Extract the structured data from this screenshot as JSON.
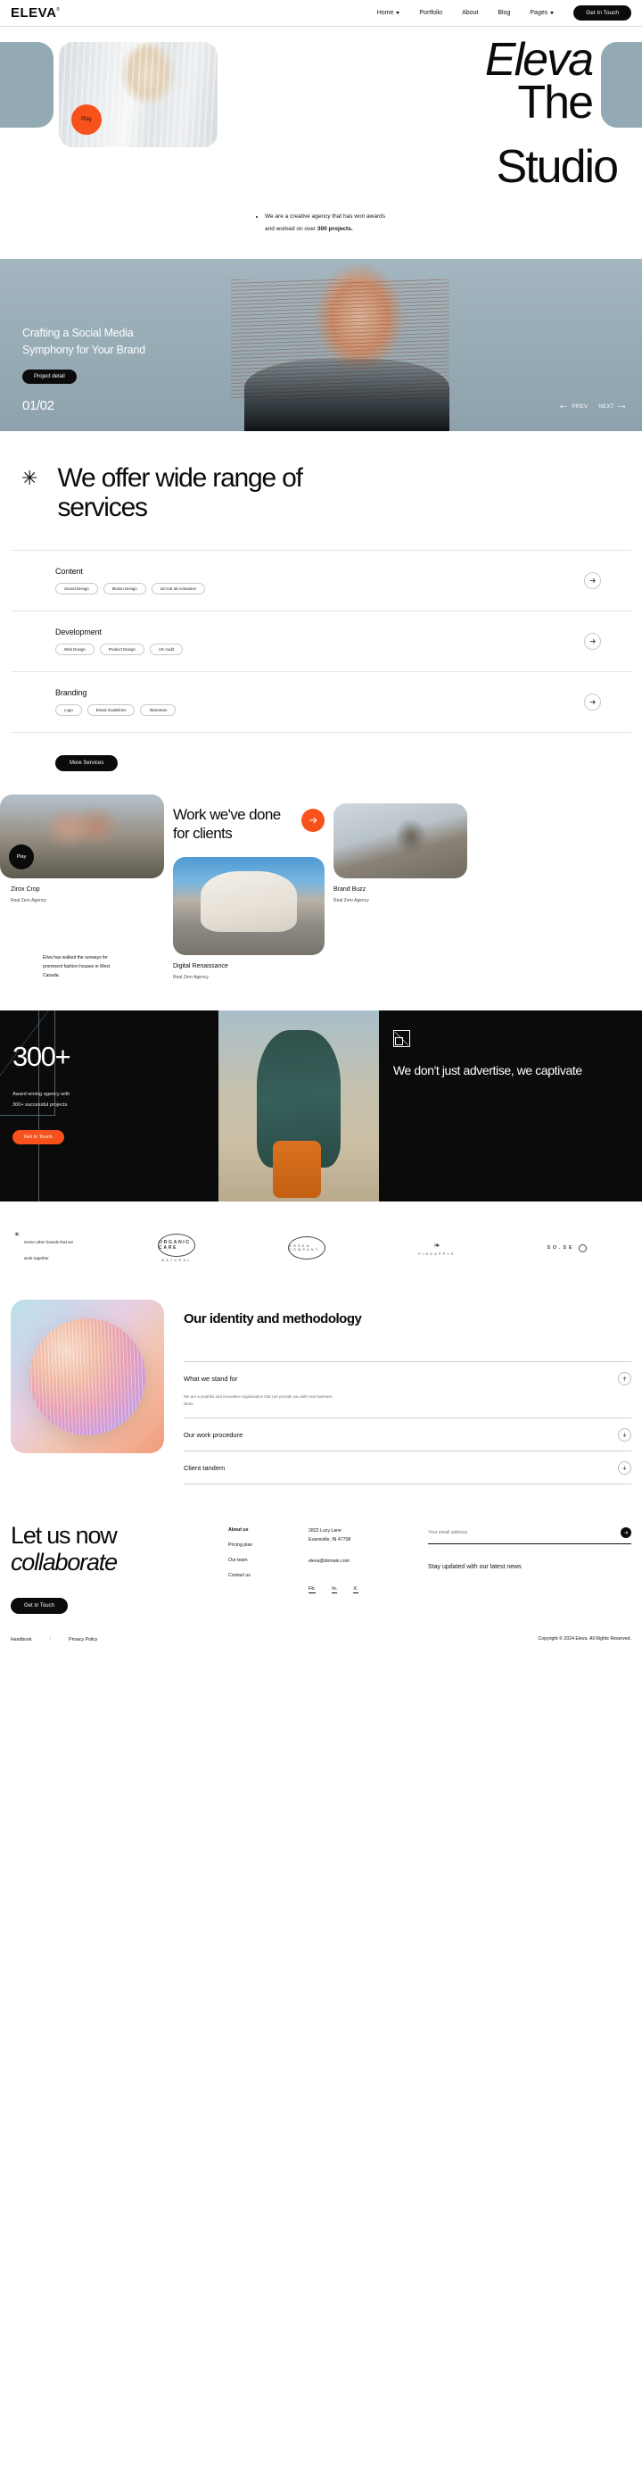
{
  "header": {
    "logo": "ELEVA",
    "logo_mark": "®",
    "nav": [
      {
        "label": "Home",
        "has_caret": true
      },
      {
        "label": "Portfolio",
        "has_caret": false
      },
      {
        "label": "About",
        "has_caret": false
      },
      {
        "label": "Blog",
        "has_caret": false
      },
      {
        "label": "Pages",
        "has_caret": true
      }
    ],
    "cta": "Get In Touch"
  },
  "hero": {
    "title_italic": "Eleva",
    "title_line2": "The",
    "title_line3": "Studio",
    "play": "Play",
    "sub_line1": "We are a creative agency that has won awards",
    "sub_line2_pre": "and worked on over ",
    "sub_line2_bold": "300 projects."
  },
  "slider": {
    "headline_l1": "Crafting a Social Media",
    "headline_l2": "Symphony for Your Brand",
    "cta": "Project detail",
    "counter": "01/02",
    "prev": "PREV",
    "next": "NEXT"
  },
  "services": {
    "asterisk": "✳",
    "heading": "We offer wide range of services",
    "items": [
      {
        "title": "Content",
        "tags": [
          "Sound Design",
          "Motion Design",
          "2d And 3d Animation"
        ]
      },
      {
        "title": "Development",
        "tags": [
          "Web Design",
          "Product Design",
          "UX Audit"
        ]
      },
      {
        "title": "Branding",
        "tags": [
          "Logo",
          "Brand Guidelines",
          "Illustration"
        ]
      }
    ],
    "more_label": "More Services"
  },
  "work": {
    "heading": "Work we've done for clients",
    "play": "Play",
    "blurb": "Eliva has walked the runways for prominent fashion houses in West Canada.",
    "cards": [
      {
        "title": "Zirox Crop",
        "agency": "Real Zero Agency"
      },
      {
        "title": "Digital Renaissance",
        "agency": "Real Zero Agency"
      },
      {
        "title": "Brand Buzz",
        "agency": "Real Zero Agency"
      }
    ]
  },
  "stats": {
    "number": "300+",
    "caption_l1": "Award wining agency with",
    "caption_l2": "300+ successful projects",
    "cta": "Get In Touch",
    "right_heading": "We don't just advertise, we captivate"
  },
  "brands": {
    "lead_l1": "Some other brands that we",
    "lead_l2": "work together",
    "logos": [
      {
        "name": "ORGANIC CARE",
        "sub": "NATURAL"
      },
      {
        "name": "GREEN COMPANY",
        "sub": ""
      },
      {
        "name": "PINEAPPLE",
        "sub": ""
      },
      {
        "name": "SO.SE",
        "sub": ""
      }
    ]
  },
  "identity": {
    "heading": "Our identity and methodology",
    "accordion": [
      {
        "title": "What we stand for",
        "body": "We are a youthful and innovative organisation that can provide you with new business ideas.",
        "open": true
      },
      {
        "title": "Our work procedure",
        "body": "",
        "open": false
      },
      {
        "title": "Client tandem",
        "body": "",
        "open": false
      }
    ]
  },
  "footer": {
    "heading_l1": "Let us now",
    "heading_l2": "collaborate",
    "cta": "Get In Touch",
    "links": [
      "About us",
      "Pricing plan",
      "Our team",
      "Contact us"
    ],
    "address_l1": "2822 Lucy Lane",
    "address_l2": "Evansville, IN 47708",
    "email": "eleva@domain.com",
    "socials": [
      "Fb.",
      "In.",
      "X."
    ],
    "newsletter_placeholder": "Your email address",
    "newsletter_note": "Stay updated with our latest news",
    "bottom_links": [
      "Handbook",
      "Privacy Policy"
    ],
    "separator": "/",
    "copyright": "Copyright © 2024 Eleva. All Rights Reserved."
  },
  "colors": {
    "accent": "#f7521b",
    "dark": "#0b0b0b",
    "blue": "#93aab4"
  }
}
